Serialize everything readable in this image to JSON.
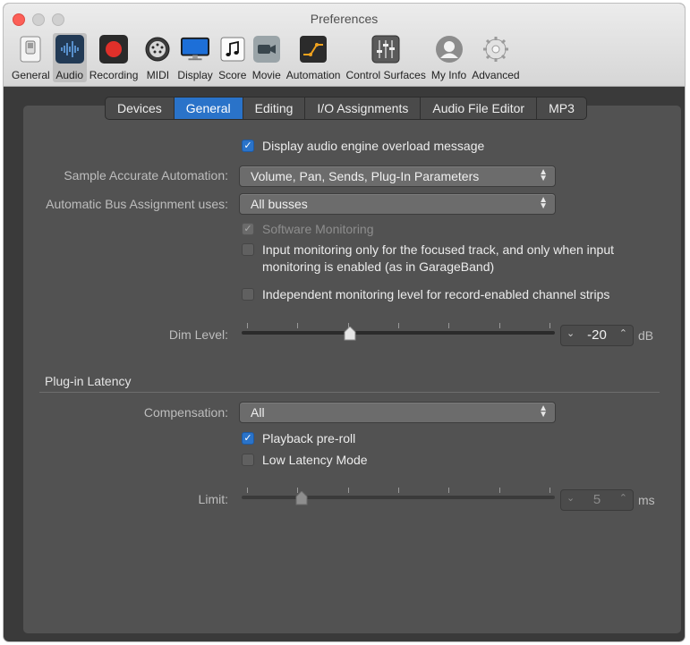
{
  "window": {
    "title": "Preferences"
  },
  "toolbar": {
    "items": [
      {
        "label": "General",
        "icon": "switch-icon"
      },
      {
        "label": "Audio",
        "icon": "waveform-icon",
        "selected": true
      },
      {
        "label": "Recording",
        "icon": "record-icon"
      },
      {
        "label": "MIDI",
        "icon": "midi-port-icon"
      },
      {
        "label": "Display",
        "icon": "monitor-icon"
      },
      {
        "label": "Score",
        "icon": "music-note-icon"
      },
      {
        "label": "Movie",
        "icon": "movie-camera-icon"
      },
      {
        "label": "Automation",
        "icon": "automation-curve-icon"
      },
      {
        "label": "Control Surfaces",
        "icon": "faders-icon"
      },
      {
        "label": "My Info",
        "icon": "user-icon"
      },
      {
        "label": "Advanced",
        "icon": "gear-icon"
      }
    ]
  },
  "tabs": [
    "Devices",
    "General",
    "Editing",
    "I/O Assignments",
    "Audio File Editor",
    "MP3"
  ],
  "active_tab": "General",
  "general": {
    "overload_message": {
      "label": "Display audio engine overload message",
      "checked": true
    },
    "sample_accurate": {
      "label": "Sample Accurate Automation:",
      "value": "Volume, Pan, Sends, Plug-In Parameters"
    },
    "bus_assignment": {
      "label": "Automatic Bus Assignment uses:",
      "value": "All busses"
    },
    "software_monitoring": {
      "label": "Software Monitoring",
      "checked": true,
      "enabled": false
    },
    "input_monitoring_line1": "Input monitoring only for the focused track, and only when input",
    "input_monitoring_line2": "monitoring is enabled (as in GarageBand)",
    "independent_monitoring": {
      "label": "Independent monitoring level for record-enabled channel strips",
      "checked": false
    },
    "dim_level": {
      "label": "Dim Level:",
      "value": "-20",
      "unit": "dB",
      "slider_fraction": 0.34
    }
  },
  "plugin_latency": {
    "title": "Plug-in Latency",
    "compensation": {
      "label": "Compensation:",
      "value": "All"
    },
    "playback_preroll": {
      "label": "Playback pre-roll",
      "checked": true
    },
    "low_latency": {
      "label": "Low Latency Mode",
      "checked": false
    },
    "limit": {
      "label": "Limit:",
      "value": "5",
      "unit": "ms",
      "slider_fraction": 0.18,
      "enabled": false
    }
  },
  "colors": {
    "accent": "#2a73c9",
    "record": "#e0302a"
  }
}
